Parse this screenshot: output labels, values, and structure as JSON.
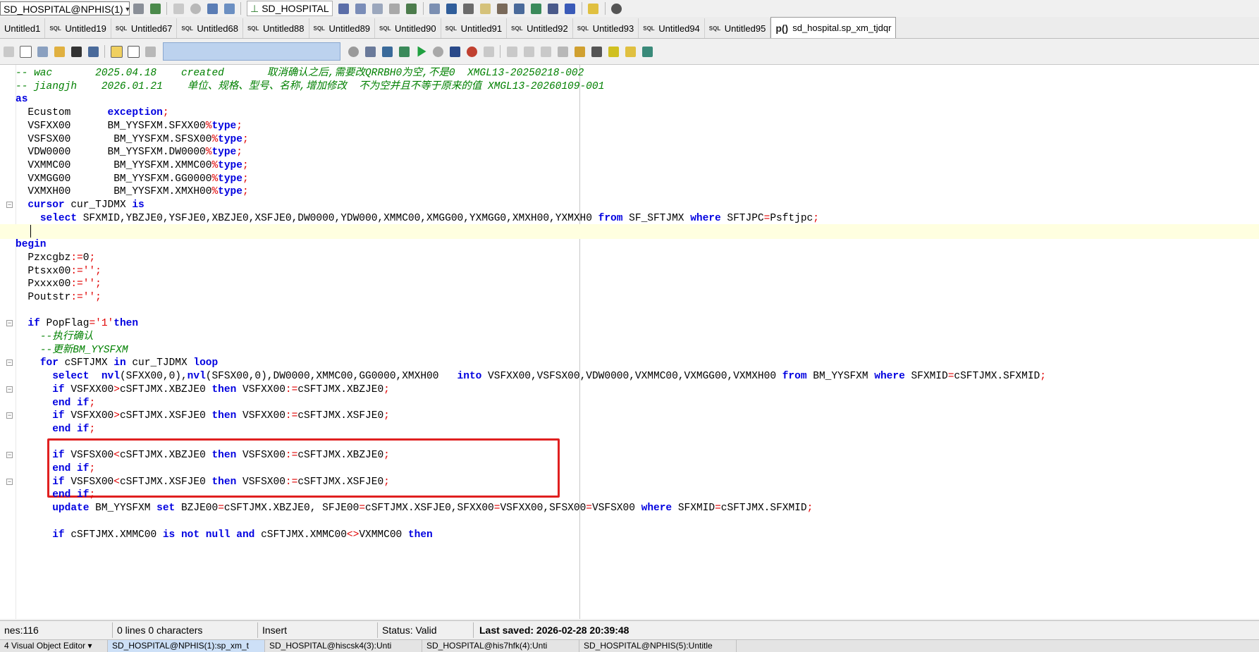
{
  "toolbar": {
    "connection": "SD_HOSPITAL@NPHIS(1)",
    "database": "SD_HOSPITAL"
  },
  "tabs": [
    {
      "label": "Untitled1",
      "sql": false
    },
    {
      "label": "Untitled19",
      "sql": true
    },
    {
      "label": "Untitled67",
      "sql": true
    },
    {
      "label": "Untitled68",
      "sql": true
    },
    {
      "label": "Untitled88",
      "sql": true
    },
    {
      "label": "Untitled89",
      "sql": true
    },
    {
      "label": "Untitled90",
      "sql": true
    },
    {
      "label": "Untitled91",
      "sql": true
    },
    {
      "label": "Untitled92",
      "sql": true
    },
    {
      "label": "Untitled93",
      "sql": true
    },
    {
      "label": "Untitled94",
      "sql": true
    },
    {
      "label": "Untitled95",
      "sql": true
    }
  ],
  "active_tab": {
    "prefix": "p()",
    "label": "sd_hospital.sp_xm_tjdqr"
  },
  "sql_tag": "SQL",
  "code": [
    [
      [
        "cm",
        "-- wac       2025.04.18    created       取消确认之后,需要改QRRBH0为空,不是0  XMGL13-20250218-002"
      ]
    ],
    [
      [
        "cm",
        "-- jiangjh    2026.01.21    单位、规格、型号、名称,增加修改  不为空并且不等于原来的值 XMGL13-20260109-001"
      ]
    ],
    [
      [
        "kw",
        "as"
      ]
    ],
    [
      [
        "",
        "  Ecustom      "
      ],
      [
        "kw",
        "exception"
      ],
      [
        "op",
        ";"
      ]
    ],
    [
      [
        "",
        "  VSFXX00      BM_YYSFXM.SFXX00"
      ],
      [
        "op",
        "%"
      ],
      [
        "kw",
        "type"
      ],
      [
        "op",
        ";"
      ]
    ],
    [
      [
        "",
        "  VSFSX00       BM_YYSFXM.SFSX00"
      ],
      [
        "op",
        "%"
      ],
      [
        "kw",
        "type"
      ],
      [
        "op",
        ";"
      ]
    ],
    [
      [
        "",
        "  VDW0000      BM_YYSFXM.DW0000"
      ],
      [
        "op",
        "%"
      ],
      [
        "kw",
        "type"
      ],
      [
        "op",
        ";"
      ]
    ],
    [
      [
        "",
        "  VXMMC00       BM_YYSFXM.XMMC00"
      ],
      [
        "op",
        "%"
      ],
      [
        "kw",
        "type"
      ],
      [
        "op",
        ";"
      ]
    ],
    [
      [
        "",
        "  VXMGG00       BM_YYSFXM.GG0000"
      ],
      [
        "op",
        "%"
      ],
      [
        "kw",
        "type"
      ],
      [
        "op",
        ";"
      ]
    ],
    [
      [
        "",
        "  VXMXH00       BM_YYSFXM.XMXH00"
      ],
      [
        "op",
        "%"
      ],
      [
        "kw",
        "type"
      ],
      [
        "op",
        ";"
      ]
    ],
    [
      [
        "",
        "  "
      ],
      [
        "kw",
        "cursor"
      ],
      [
        "",
        " cur_TJDMX "
      ],
      [
        "kw",
        "is"
      ]
    ],
    [
      [
        "",
        "    "
      ],
      [
        "kw",
        "select"
      ],
      [
        "",
        " SFXMID,YBZJE0,YSFJE0,XBZJE0,XSFJE0,DW0000,YDW000,XMMC00,XMGG00,YXMGG0,XMXH00,YXMXH0 "
      ],
      [
        "kw",
        "from"
      ],
      [
        "",
        " SF_SFTJMX "
      ],
      [
        "kw",
        "where"
      ],
      [
        "",
        " SFTJPC"
      ],
      [
        "op",
        "="
      ],
      [
        "",
        "Psftjpc"
      ],
      [
        "op",
        ";"
      ]
    ],
    [
      [
        "",
        ""
      ]
    ],
    [
      [
        "kw",
        "begin"
      ]
    ],
    [
      [
        "",
        "  Pzxcgbz"
      ],
      [
        "op",
        ":="
      ],
      [
        "",
        "0"
      ],
      [
        "op",
        ";"
      ]
    ],
    [
      [
        "",
        "  Ptsxx00"
      ],
      [
        "op",
        ":="
      ],
      [
        "str",
        "''"
      ],
      [
        "op",
        ";"
      ]
    ],
    [
      [
        "",
        "  Pxxxx00"
      ],
      [
        "op",
        ":="
      ],
      [
        "str",
        "''"
      ],
      [
        "op",
        ";"
      ]
    ],
    [
      [
        "",
        "  Poutstr"
      ],
      [
        "op",
        ":="
      ],
      [
        "str",
        "''"
      ],
      [
        "op",
        ";"
      ]
    ],
    [
      [
        "",
        ""
      ]
    ],
    [
      [
        "",
        "  "
      ],
      [
        "kw",
        "if"
      ],
      [
        "",
        " PopFlag"
      ],
      [
        "op",
        "="
      ],
      [
        "str",
        "'1'"
      ],
      [
        "",
        "",
        " "
      ],
      [
        "kw",
        "then"
      ]
    ],
    [
      [
        "",
        "    "
      ],
      [
        "cm",
        "--执行确认"
      ]
    ],
    [
      [
        "",
        "    "
      ],
      [
        "cm",
        "--更新BM_YYSFXM"
      ]
    ],
    [
      [
        "",
        "    "
      ],
      [
        "kw",
        "for"
      ],
      [
        "",
        " cSFTJMX "
      ],
      [
        "kw",
        "in"
      ],
      [
        "",
        " cur_TJDMX "
      ],
      [
        "kw",
        "loop"
      ]
    ],
    [
      [
        "",
        "      "
      ],
      [
        "kw",
        "select"
      ],
      [
        "",
        "  "
      ],
      [
        "kw",
        "nvl"
      ],
      [
        "",
        "(SFXX00,0),"
      ],
      [
        "kw",
        "nvl"
      ],
      [
        "",
        "(SFSX00,0),DW0000,XMMC00,GG0000,XMXH00   "
      ],
      [
        "kw",
        "into"
      ],
      [
        "",
        " VSFXX00,VSFSX00,VDW0000,VXMMC00,VXMGG00,VXMXH00 "
      ],
      [
        "kw",
        "from"
      ],
      [
        "",
        " BM_YYSFXM "
      ],
      [
        "kw",
        "where"
      ],
      [
        "",
        " SFXMID"
      ],
      [
        "op",
        "="
      ],
      [
        "",
        "cSFTJMX.SFXMID"
      ],
      [
        "op",
        ";"
      ]
    ],
    [
      [
        "",
        "      "
      ],
      [
        "kw",
        "if"
      ],
      [
        "",
        " VSFXX00"
      ],
      [
        "op",
        ">"
      ],
      [
        "",
        "cSFTJMX.XBZJE0 "
      ],
      [
        "kw",
        "then"
      ],
      [
        "",
        " VSFXX00"
      ],
      [
        "op",
        ":="
      ],
      [
        "",
        "cSFTJMX.XBZJE0"
      ],
      [
        "op",
        ";"
      ]
    ],
    [
      [
        "",
        "      "
      ],
      [
        "kw",
        "end if"
      ],
      [
        "op",
        ";"
      ]
    ],
    [
      [
        "",
        "      "
      ],
      [
        "kw",
        "if"
      ],
      [
        "",
        " VSFXX00"
      ],
      [
        "op",
        ">"
      ],
      [
        "",
        "cSFTJMX.XSFJE0 "
      ],
      [
        "kw",
        "then"
      ],
      [
        "",
        " VSFXX00"
      ],
      [
        "op",
        ":="
      ],
      [
        "",
        "cSFTJMX.XSFJE0"
      ],
      [
        "op",
        ";"
      ]
    ],
    [
      [
        "",
        "      "
      ],
      [
        "kw",
        "end if"
      ],
      [
        "op",
        ";"
      ]
    ],
    [
      [
        "",
        ""
      ]
    ],
    [
      [
        "",
        "      "
      ],
      [
        "kw",
        "if"
      ],
      [
        "",
        " VSFSX00"
      ],
      [
        "op",
        "<"
      ],
      [
        "",
        "cSFTJMX.XBZJE0 "
      ],
      [
        "kw",
        "then"
      ],
      [
        "",
        " VSFSX00"
      ],
      [
        "op",
        ":="
      ],
      [
        "",
        "cSFTJMX.XBZJE0"
      ],
      [
        "op",
        ";"
      ]
    ],
    [
      [
        "",
        "      "
      ],
      [
        "kw",
        "end if"
      ],
      [
        "op",
        ";"
      ]
    ],
    [
      [
        "",
        "      "
      ],
      [
        "kw",
        "if"
      ],
      [
        "",
        " VSFSX00"
      ],
      [
        "op",
        "<"
      ],
      [
        "",
        "cSFTJMX.XSFJE0 "
      ],
      [
        "kw",
        "then"
      ],
      [
        "",
        " VSFSX00"
      ],
      [
        "op",
        ":="
      ],
      [
        "",
        "cSFTJMX.XSFJE0"
      ],
      [
        "op",
        ";"
      ]
    ],
    [
      [
        "",
        "      "
      ],
      [
        "kw",
        "end if"
      ],
      [
        "op",
        ";"
      ]
    ],
    [
      [
        "",
        "      "
      ],
      [
        "kw",
        "update"
      ],
      [
        "",
        " BM_YYSFXM "
      ],
      [
        "kw",
        "set"
      ],
      [
        "",
        " BZJE00"
      ],
      [
        "op",
        "="
      ],
      [
        "",
        "cSFTJMX.XBZJE0, SFJE00"
      ],
      [
        "op",
        "="
      ],
      [
        "",
        "cSFTJMX.XSFJE0,SFXX00"
      ],
      [
        "op",
        "="
      ],
      [
        "",
        "VSFXX00,SFSX00"
      ],
      [
        "op",
        "="
      ],
      [
        "",
        "VSFSX00 "
      ],
      [
        "kw",
        "where"
      ],
      [
        "",
        " SFXMID"
      ],
      [
        "op",
        "="
      ],
      [
        "",
        "cSFTJMX.SFXMID"
      ],
      [
        "op",
        ";"
      ]
    ],
    [
      [
        "",
        ""
      ]
    ],
    [
      [
        "",
        "      "
      ],
      [
        "kw",
        "if"
      ],
      [
        "",
        " cSFTJMX.XMMC00 "
      ],
      [
        "kw",
        "is not null and"
      ],
      [
        "",
        " cSFTJMX.XMMC00"
      ],
      [
        "op",
        "<>"
      ],
      [
        "",
        "VXMMC00 "
      ],
      [
        "kw",
        "then"
      ]
    ]
  ],
  "status": {
    "lines": "nes:116",
    "selection": "0 lines 0 characters",
    "mode": "Insert",
    "state": "Status: Valid",
    "saved": "Last saved: 2026-02-28 20:39:48"
  },
  "windows": [
    {
      "label": "4 Visual Object Editor ▾"
    },
    {
      "label": "SD_HOSPITAL@NPHIS(1):sp_xm_t"
    },
    {
      "label": "SD_HOSPITAL@hiscsk4(3):Unti"
    },
    {
      "label": "SD_HOSPITAL@his7hfk(4):Unti"
    },
    {
      "label": "SD_HOSPITAL@NPHIS(5):Untitle"
    }
  ]
}
